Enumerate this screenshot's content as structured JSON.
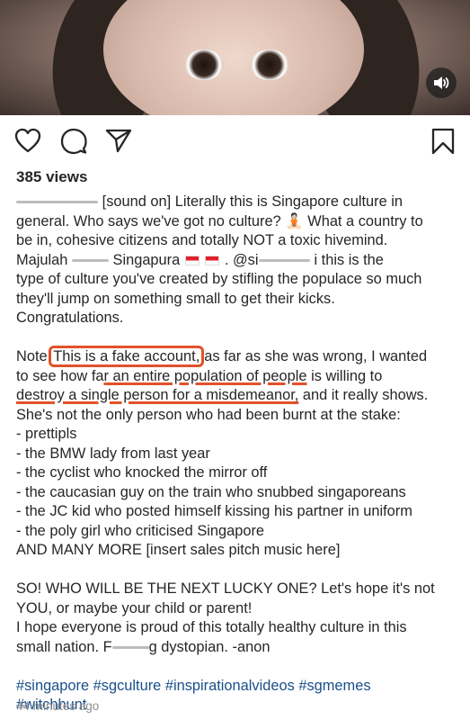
{
  "post": {
    "views": "385 views",
    "time": "44 minutes ago"
  },
  "caption": {
    "l1_a": "[sound on] Literally this is Singapore culture in",
    "l2_a": "general. Who says we've got no culture?",
    "l2_emoji": "🧘🏻",
    "l2_b": "What a country to",
    "l3": "be in, cohesive citizens and totally NOT a toxic hivemind.",
    "l4_a": "Majulah",
    "l4_b": "Singapura",
    "l4_flag1": "🇸🇬",
    "l4_flag2": "🇸🇬",
    "l4_c": ". @si",
    "l4_d": "i this is the",
    "l5": "type of culture you've created by stifling the populace so much",
    "l6": "they'll jump on something small to get their kicks.",
    "l7": "Congratulations.",
    "note_a": "Note:",
    "note_box": "This is a fake account,",
    "note_b": "as far as she was wrong, I wanted",
    "n2_a": "to see how fa",
    "n2_u": "r an entire population of people",
    "n2_b": "is willing to",
    "n3_u": "destroy a single person for a misdemeanor,",
    "n3_b": "and it really shows.",
    "n4": "She's not the only person who had been burnt at the stake:",
    "list": [
      "- prettipls",
      "- the BMW lady from last year",
      "- the cyclist who knocked the mirror off",
      "- the caucasian guy on the train who snubbed singaporeans",
      "- the JC kid who posted himself kissing his partner in uniform",
      "- the poly girl who criticised Singapore"
    ],
    "more": "AND MANY MORE [insert sales pitch music here]",
    "so1": "SO! WHO WILL BE THE NEXT LUCKY ONE? Let's hope it's not",
    "so2": "YOU, or maybe your child or parent!",
    "hope1": "I hope everyone is proud of this totally healthy culture in this",
    "hope2_a": "small nation. F",
    "hope2_b": "g dystopian. -anon",
    "tags1": "#singapore #sgculture #inspirationalvideos #sgmemes",
    "tags2": "#witchhunt"
  },
  "icons": {
    "like": "heart-icon",
    "comment": "comment-icon",
    "share": "paper-plane-icon",
    "save": "bookmark-icon",
    "volume": "speaker-icon"
  }
}
